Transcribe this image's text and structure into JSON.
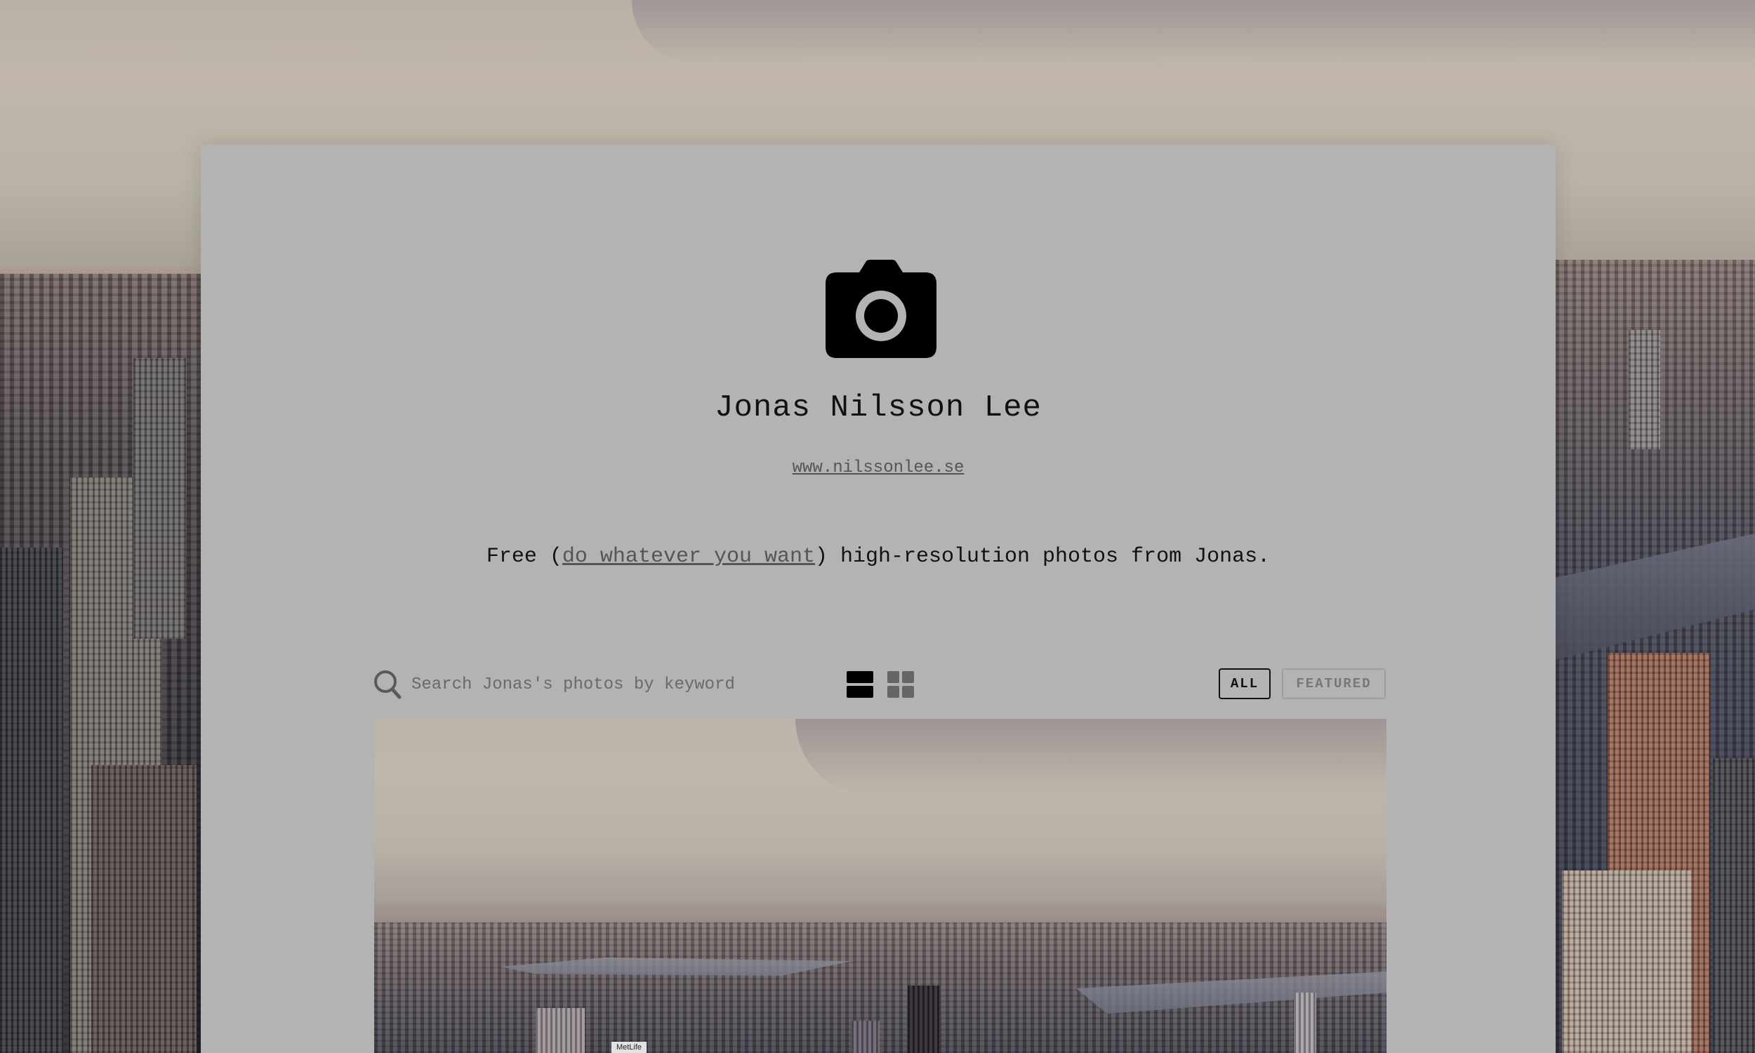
{
  "profile": {
    "name": "Jonas Nilsson Lee",
    "website": "www.nilssonlee.se",
    "tagline_prefix": "Free (",
    "tagline_link": "do whatever you want",
    "tagline_suffix": ") high-resolution photos from Jonas."
  },
  "toolbar": {
    "search_placeholder": "Search Jonas's photos by keyword",
    "search_value": "",
    "filter_all": "ALL",
    "filter_featured": "FEATURED",
    "active_filter": "ALL",
    "active_view": "list"
  },
  "photo": {
    "billboard_text": "MetLife"
  },
  "icons": {
    "camera": "camera-icon",
    "search": "search-icon",
    "list_view": "list-view-icon",
    "grid_view": "grid-view-icon"
  },
  "colors": {
    "panel_background": "#b3b3b3",
    "text_primary": "#111111",
    "link": "#555555",
    "inactive_button": "#777777"
  }
}
